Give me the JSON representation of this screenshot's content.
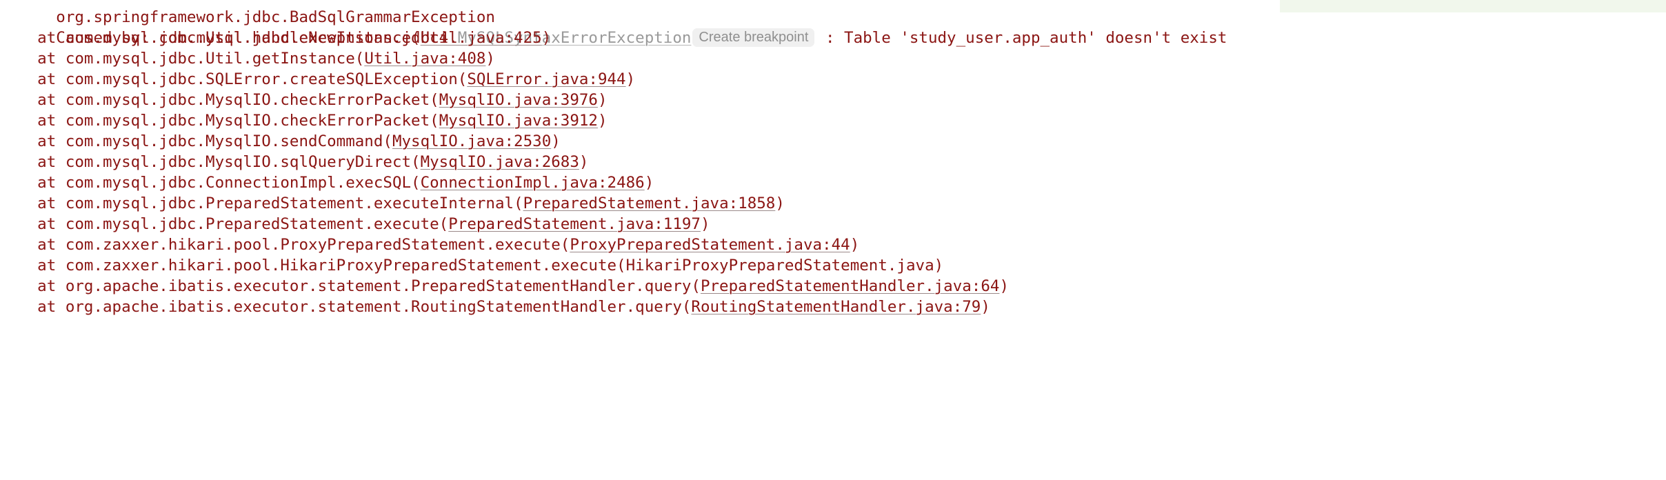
{
  "console": {
    "background_color": "#ffffff",
    "text_color": "#8b1513",
    "link_color": "#8b1513",
    "muted_color": "#9a9a9a",
    "chip_background": "#f0f0f0",
    "highlight_tint": "#f1f7ec"
  },
  "clipped_top_line": {
    "text": "org.springframework.jdbc.BadSqlGrammarException"
  },
  "header": {
    "prefix": "Caused by: com.mysql.jdbc.exceptions.jdbc4.",
    "exception_class": "MySQLSyntaxErrorException",
    "breakpoint_chip": "Create breakpoint",
    "separator": " : ",
    "message": "Table 'study_user.app_auth' doesn't exist"
  },
  "frames": [
    {
      "indent": "    at ",
      "method": "com.mysql.jdbc.Util.handleNewInstance(",
      "link": "Util.java:425",
      "suffix": ")"
    },
    {
      "indent": "    at ",
      "method": "com.mysql.jdbc.Util.getInstance(",
      "link": "Util.java:408",
      "suffix": ")"
    },
    {
      "indent": "    at ",
      "method": "com.mysql.jdbc.SQLError.createSQLException(",
      "link": "SQLError.java:944",
      "suffix": ")"
    },
    {
      "indent": "    at ",
      "method": "com.mysql.jdbc.MysqlIO.checkErrorPacket(",
      "link": "MysqlIO.java:3976",
      "suffix": ")"
    },
    {
      "indent": "    at ",
      "method": "com.mysql.jdbc.MysqlIO.checkErrorPacket(",
      "link": "MysqlIO.java:3912",
      "suffix": ")"
    },
    {
      "indent": "    at ",
      "method": "com.mysql.jdbc.MysqlIO.sendCommand(",
      "link": "MysqlIO.java:2530",
      "suffix": ")"
    },
    {
      "indent": "    at ",
      "method": "com.mysql.jdbc.MysqlIO.sqlQueryDirect(",
      "link": "MysqlIO.java:2683",
      "suffix": ")"
    },
    {
      "indent": "    at ",
      "method": "com.mysql.jdbc.ConnectionImpl.execSQL(",
      "link": "ConnectionImpl.java:2486",
      "suffix": ")"
    },
    {
      "indent": "    at ",
      "method": "com.mysql.jdbc.PreparedStatement.executeInternal(",
      "link": "PreparedStatement.java:1858",
      "suffix": ")"
    },
    {
      "indent": "    at ",
      "method": "com.mysql.jdbc.PreparedStatement.execute(",
      "link": "PreparedStatement.java:1197",
      "suffix": ")"
    },
    {
      "indent": "    at ",
      "method": "com.zaxxer.hikari.pool.ProxyPreparedStatement.execute(",
      "link": "ProxyPreparedStatement.java:44",
      "suffix": ")"
    },
    {
      "indent": "    at ",
      "method": "com.zaxxer.hikari.pool.HikariProxyPreparedStatement.execute(HikariProxyPreparedStatement.java)",
      "link": "",
      "suffix": ""
    },
    {
      "indent": "    at ",
      "method": "org.apache.ibatis.executor.statement.PreparedStatementHandler.query(",
      "link": "PreparedStatementHandler.java:64",
      "suffix": ")"
    },
    {
      "indent": "    at ",
      "method": "org.apache.ibatis.executor.statement.RoutingStatementHandler.query(",
      "link": "RoutingStatementHandler.java:79",
      "suffix": ")"
    }
  ]
}
